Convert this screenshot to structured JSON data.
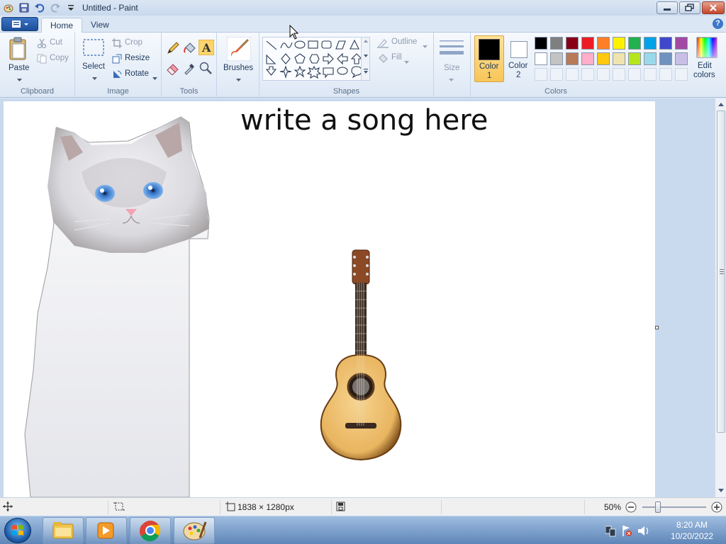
{
  "window": {
    "title": "Untitled - Paint"
  },
  "tabs": {
    "home": "Home",
    "view": "View"
  },
  "ribbon": {
    "clipboard": {
      "label": "Clipboard",
      "paste": "Paste",
      "cut": "Cut",
      "copy": "Copy"
    },
    "image": {
      "label": "Image",
      "select": "Select",
      "crop": "Crop",
      "resize": "Resize",
      "rotate": "Rotate"
    },
    "tools": {
      "label": "Tools"
    },
    "brushes": {
      "label": "Brushes"
    },
    "shapes": {
      "label": "Shapes",
      "outline": "Outline",
      "fill": "Fill"
    },
    "size": {
      "label": "Size"
    },
    "colors": {
      "label": "Colors",
      "color1_line1": "Color",
      "color1_line2": "1",
      "color2_line1": "Color",
      "color2_line2": "2",
      "edit_line1": "Edit",
      "edit_line2": "colors",
      "color1": "#000000",
      "color2": "#ffffff",
      "palette_row1": [
        "#000000",
        "#7f7f7f",
        "#880015",
        "#ed1c24",
        "#ff7f27",
        "#fff200",
        "#22b14c",
        "#00a2e8",
        "#3f48cc",
        "#a349a4"
      ],
      "palette_row2": [
        "#ffffff",
        "#c3c3c3",
        "#b97a57",
        "#ffaec9",
        "#ffc90e",
        "#efe4b0",
        "#b5e61d",
        "#99d9ea",
        "#7092be",
        "#c8bfe7"
      ]
    }
  },
  "canvas": {
    "text": "write a song here"
  },
  "statusbar": {
    "dimensions": "1838 × 1280px",
    "zoom": "50%"
  },
  "taskbar": {
    "time": "8:20 AM",
    "date": "10/20/2022"
  }
}
